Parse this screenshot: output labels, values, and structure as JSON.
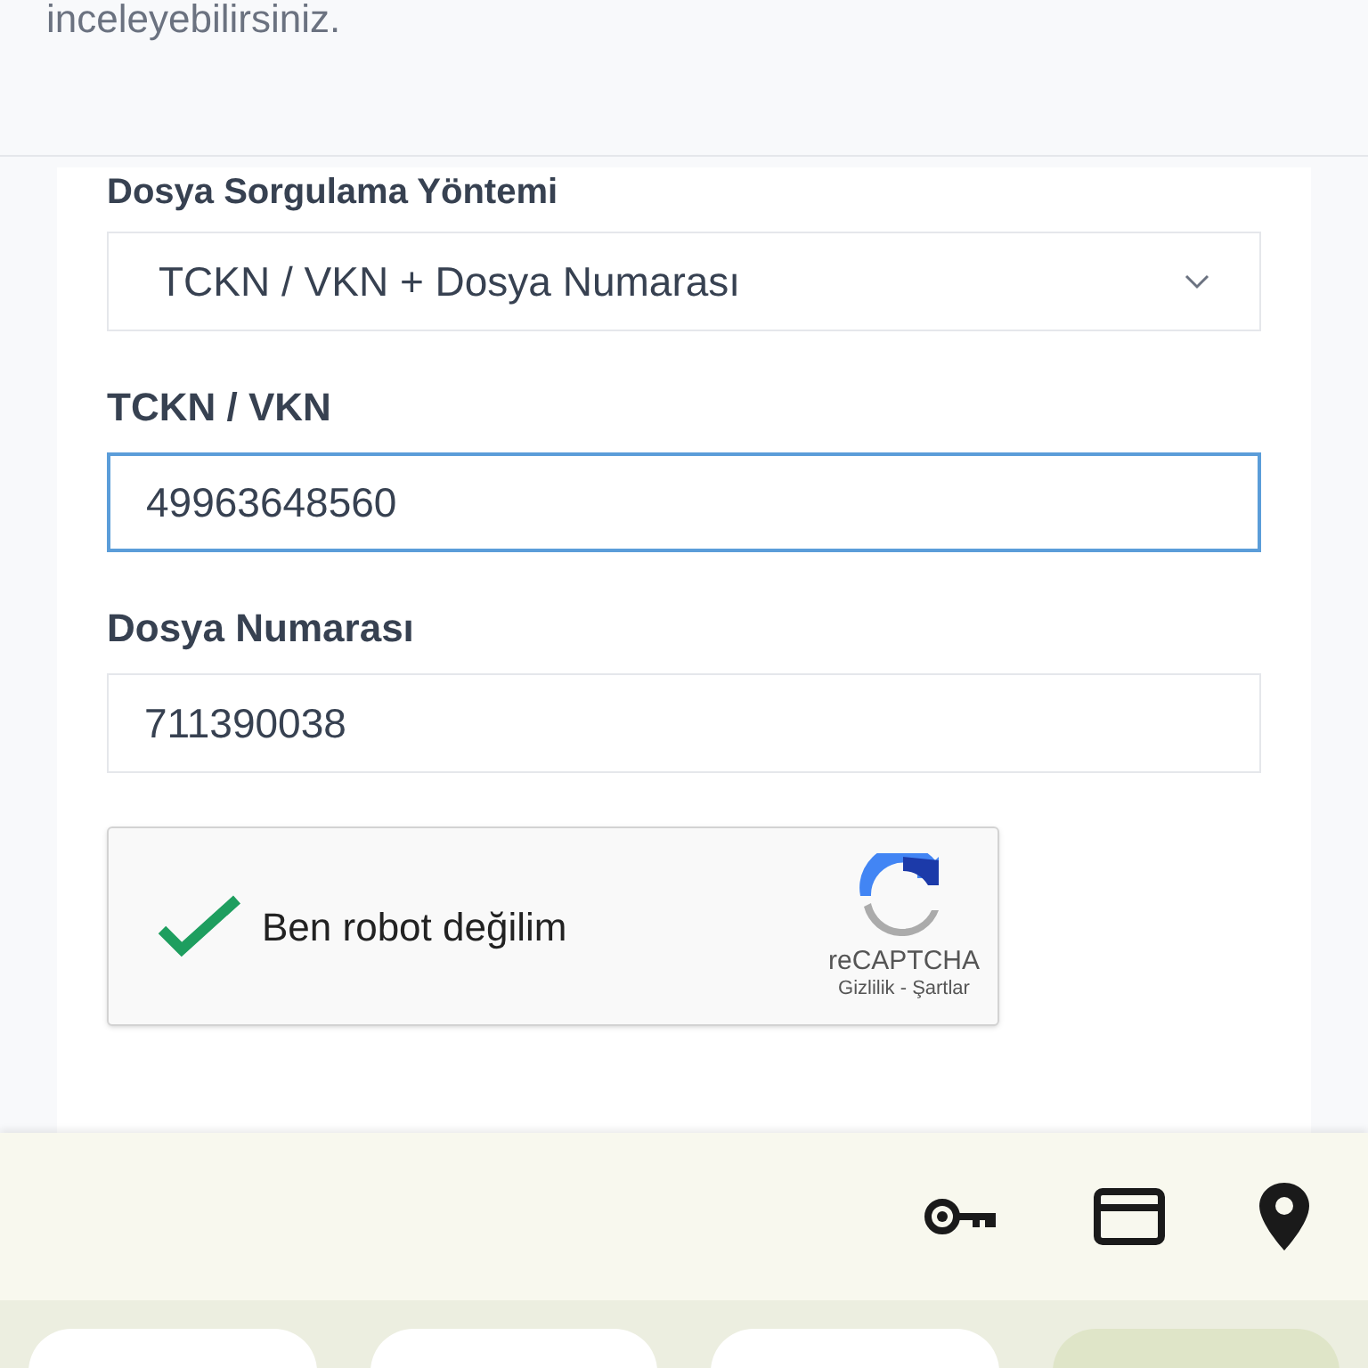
{
  "intro": {
    "text": "inceleyebilirsiniz."
  },
  "form": {
    "method_label": "Dosya Sorgulama Yöntemi",
    "method_select": {
      "value": "TCKN / VKN + Dosya Numarası"
    },
    "fields": [
      {
        "label": "TCKN / VKN",
        "value": "49963648560",
        "focused": true
      },
      {
        "label": "Dosya Numarası",
        "value": "711390038",
        "focused": false
      }
    ],
    "captcha": {
      "label": "Ben robot değilim",
      "checked": true,
      "brand": "reCAPTCHA",
      "links": "Gizlilik - Şartlar"
    }
  },
  "suggestion_chips": [
    {
      "selected": false
    },
    {
      "selected": false
    },
    {
      "selected": false
    },
    {
      "selected": true
    }
  ]
}
